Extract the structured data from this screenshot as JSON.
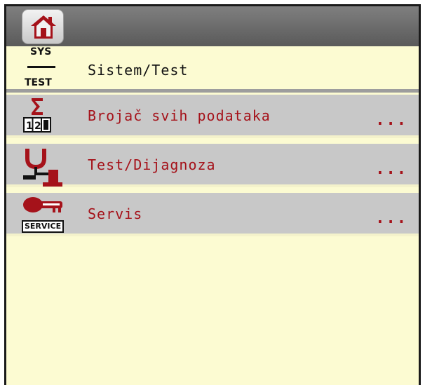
{
  "colors": {
    "background": "#fcfbd2",
    "topbar": "#6b6b6b",
    "row_bg": "#c8c8c8",
    "accent_red": "#a5121a",
    "text_dark": "#111111"
  },
  "topbar": {
    "home_icon": "home-icon"
  },
  "header": {
    "icon_top": "SYS",
    "icon_bottom": "TEST",
    "title": "Sistem/Test"
  },
  "menu": [
    {
      "icon": "counter-sigma-icon",
      "label": "Brojač svih podataka",
      "more": "..."
    },
    {
      "icon": "diagnosis-stethoscope-icon",
      "label": "Test/Dijagnoza",
      "more": "..."
    },
    {
      "icon": "service-key-icon",
      "icon_text": "SERVICE",
      "label": "Servis",
      "more": "..."
    }
  ]
}
